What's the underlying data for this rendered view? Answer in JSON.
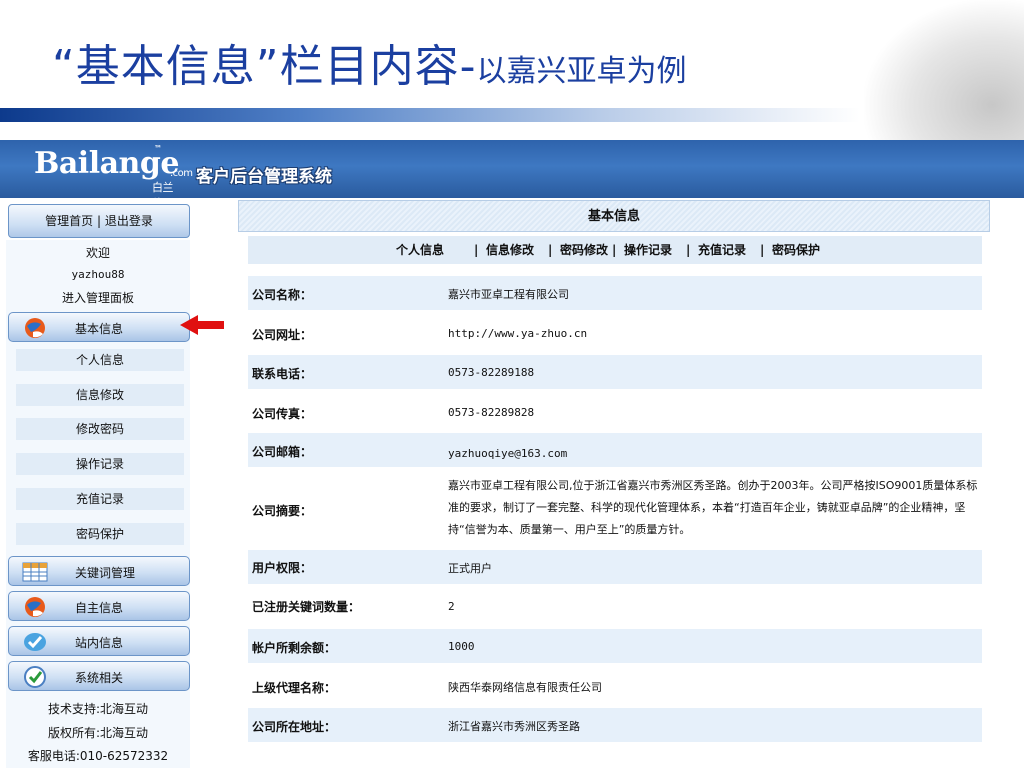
{
  "slide": {
    "title_main": "“基本信息”栏目内容-",
    "title_sub": "以嘉兴亚卓为例"
  },
  "header": {
    "logo_text": "Bailang",
    "logo_e": "e",
    "logo_tm": "™",
    "logo_com": ".com",
    "logo_cn": "白兰傍",
    "system_name": "客户后台管理系统"
  },
  "sidebar": {
    "top_links": "管理首页 | 退出登录",
    "welcome": "欢迎",
    "username": "yazhou88",
    "enter_panel": "进入管理面板",
    "section_basic": "基本信息",
    "sub_items": [
      "个人信息",
      "信息修改",
      "修改密码",
      "操作记录",
      "充值记录",
      "密码保护"
    ],
    "section_keywords": "关键词管理",
    "section_self_info": "自主信息",
    "section_site_msg": "站内信息",
    "section_system": "系统相关",
    "footer": {
      "tech_support": "技术支持:北海互动",
      "copyright": "版权所有:北海互动",
      "hotline": "客服电话:010-62572332"
    }
  },
  "main": {
    "title": "基本信息",
    "nav": [
      "个人信息",
      "信息修改",
      "密码修改",
      "操作记录",
      "充值记录",
      "密码保护"
    ],
    "nav_sep": "|",
    "fields": [
      {
        "label": "公司名称：",
        "value": "嘉兴市亚卓工程有限公司"
      },
      {
        "label": "公司网址：",
        "value": "http://www.ya-zhuo.cn"
      },
      {
        "label": "联系电话：",
        "value": "0573-82289188"
      },
      {
        "label": "公司传真：",
        "value": "0573-82289828"
      },
      {
        "label": "公司邮箱：",
        "value": "yazhuoqiye@163.com"
      },
      {
        "label": "公司摘要：",
        "value": "嘉兴市亚卓工程有限公司,位于浙江省嘉兴市秀洲区秀圣路。创办于2003年。公司严格按ISO9001质量体系标准的要求，制订了一套完整、科学的现代化管理体系，本着“打造百年企业，铸就亚卓品牌”的企业精神，坚持“信誉为本、质量第一、用户至上”的质量方针。"
      },
      {
        "label": "用户权限：",
        "value": "正式用户"
      },
      {
        "label": "已注册关键词数量：",
        "value": "2"
      },
      {
        "label": "帐户所剩余额：",
        "value": "1000"
      },
      {
        "label": "上级代理名称：",
        "value": "陕西华泰网络信息有限责任公司"
      },
      {
        "label": "公司所在地址：",
        "value": "浙江省嘉兴市秀洲区秀圣路"
      }
    ]
  },
  "colors": {
    "title_blue": "#1b3fa0",
    "header_blue": "#3e78c2",
    "row_shade": "#e6f0fa",
    "arrow_red": "#e01010"
  }
}
